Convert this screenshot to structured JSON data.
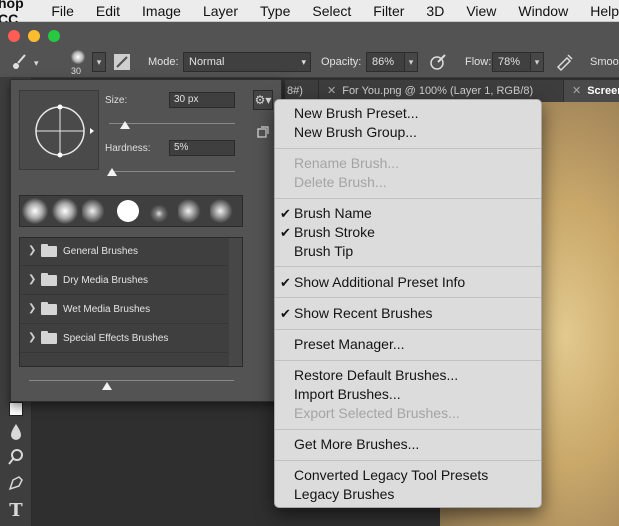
{
  "menubar": {
    "app_name": "hop CC",
    "items": [
      "File",
      "Edit",
      "Image",
      "Layer",
      "Type",
      "Select",
      "Filter",
      "3D",
      "View",
      "Window",
      "Help"
    ]
  },
  "options": {
    "brush_size": "30",
    "mode_label": "Mode:",
    "mode_value": "Normal",
    "opacity_label": "Opacity:",
    "opacity_value": "86%",
    "flow_label": "Flow:",
    "flow_value": "78%",
    "smoothing_label": "Smoo"
  },
  "tabs": [
    {
      "label": "8#)"
    },
    {
      "label": "For You.png @ 100% (Layer 1, RGB/8)"
    },
    {
      "label": "Screen"
    }
  ],
  "panel": {
    "size_label": "Size:",
    "size_value": "30 px",
    "hardness_label": "Hardness:",
    "hardness_value": "5%",
    "groups": [
      "General Brushes",
      "Dry Media Brushes",
      "Wet Media Brushes",
      "Special Effects Brushes"
    ]
  },
  "menu": {
    "new_brush_preset": "New Brush Preset...",
    "new_brush_group": "New Brush Group...",
    "rename_brush": "Rename Brush...",
    "delete_brush": "Delete Brush...",
    "brush_name": "Brush Name",
    "brush_stroke": "Brush Stroke",
    "brush_tip": "Brush Tip",
    "show_additional": "Show Additional Preset Info",
    "show_recent": "Show Recent Brushes",
    "preset_manager": "Preset Manager...",
    "restore_default": "Restore Default Brushes...",
    "import_brushes": "Import Brushes...",
    "export_selected": "Export Selected Brushes...",
    "get_more": "Get More Brushes...",
    "converted_legacy": "Converted Legacy Tool Presets",
    "legacy_brushes": "Legacy Brushes"
  },
  "colors": {
    "menu_bg": "#dcdcdc",
    "panel_bg": "#535353",
    "disabled_text": "#a4a4a4"
  }
}
